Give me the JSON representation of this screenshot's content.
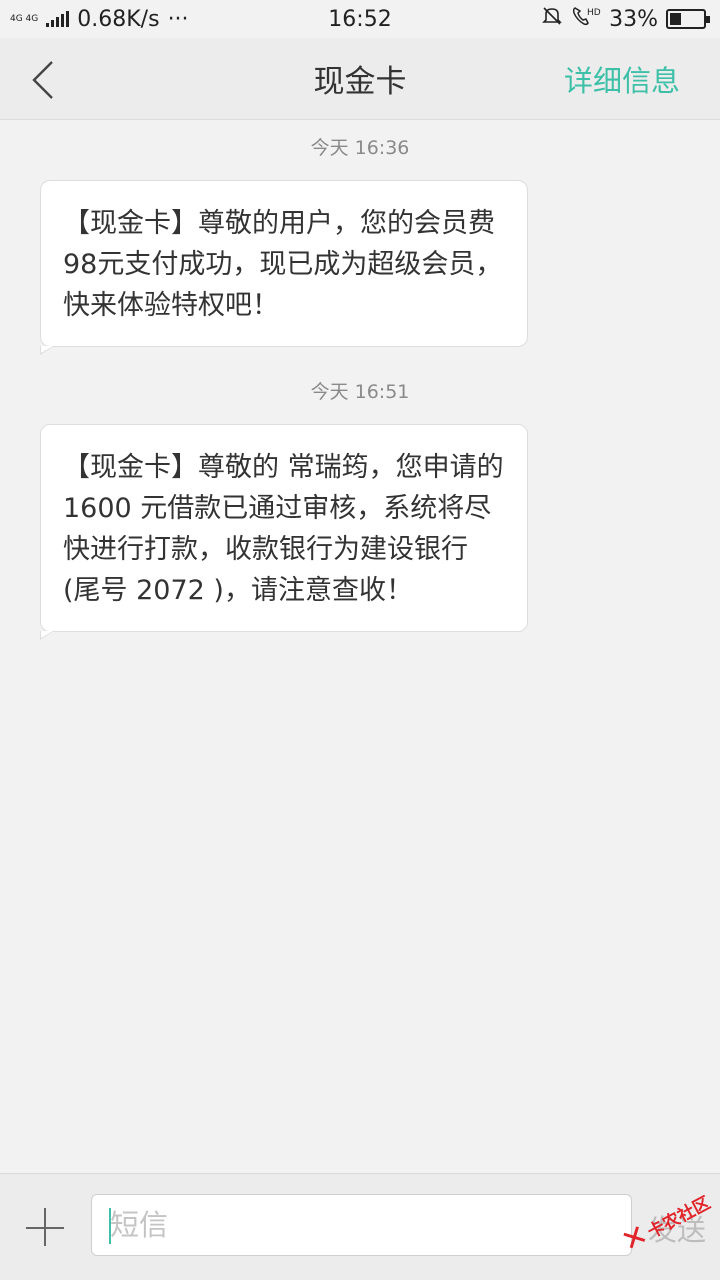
{
  "status_bar": {
    "net_top": "4G 4G",
    "speed": "0.68K/s",
    "more": "···",
    "time": "16:52",
    "battery_percent": "33%",
    "battery_level": 0.33,
    "icons": [
      "signal-icon",
      "mute-bell-icon",
      "hd-call-icon",
      "battery-icon"
    ]
  },
  "header": {
    "back_icon": "chevron-left-icon",
    "title": "现金卡",
    "detail_label": "详细信息",
    "accent_color": "#3ec0a8"
  },
  "messages": [
    {
      "time": "今天  16:36",
      "text": "【现金卡】尊敬的用户，您的会员费98元支付成功，现已成为超级会员，快来体验特权吧！"
    },
    {
      "time": "今天  16:51",
      "text": "【现金卡】尊敬的 常瑞筠，您申请的 1600 元借款已通过审核，系统将尽快进行打款，收款银行为建设银行 (尾号 2072 )，请注意查收！"
    }
  ],
  "composer": {
    "add_icon": "plus-icon",
    "placeholder": "短信",
    "value": "",
    "send_label": "发送"
  },
  "watermark": {
    "text": "卡农社区"
  }
}
